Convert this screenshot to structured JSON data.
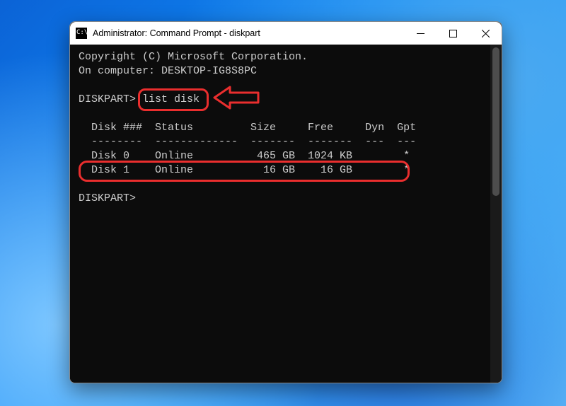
{
  "window": {
    "title": "Administrator: Command Prompt - diskpart"
  },
  "terminal": {
    "copyright": "Copyright (C) Microsoft Corporation.",
    "on_computer": "On computer: DESKTOP-IG8S8PC",
    "prompt1_prefix": "DISKPART>",
    "prompt1_cmd": " list disk",
    "header": "  Disk ###  Status         Size     Free     Dyn  Gpt",
    "divider": "  --------  -------------  -------  -------  ---  ---",
    "row0": "  Disk 0    Online          465 GB  1024 KB        *",
    "row1": "  Disk 1    Online           16 GB    16 GB        *",
    "prompt2": "DISKPART>"
  },
  "annotations": {
    "highlighted_command": "list disk",
    "highlighted_row": "Disk 1"
  },
  "colors": {
    "annotation": "#ea2e2e",
    "terminal_bg": "#0c0c0c",
    "terminal_fg": "#cccccc"
  }
}
